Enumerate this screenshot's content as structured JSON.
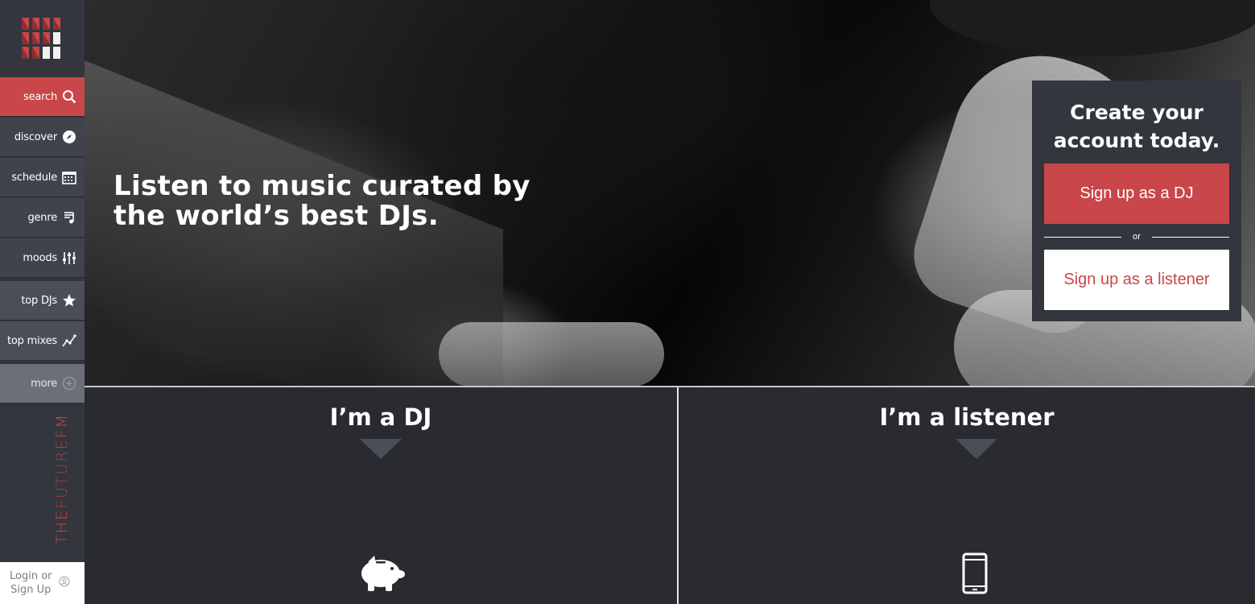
{
  "sidebar": {
    "items": [
      {
        "label": "search",
        "icon": "search-icon"
      },
      {
        "label": "discover",
        "icon": "compass-icon"
      },
      {
        "label": "schedule",
        "icon": "calendar-icon"
      },
      {
        "label": "genre",
        "icon": "music-note-icon"
      },
      {
        "label": "moods",
        "icon": "sliders-icon"
      },
      {
        "label": "top DJs",
        "icon": "star-icon"
      },
      {
        "label": "top mixes",
        "icon": "trend-line-icon"
      },
      {
        "label": "more",
        "icon": "plus-circle-icon"
      }
    ],
    "brand_part1": "THE",
    "brand_part2": "FUTURE",
    "brand_part3": "FM",
    "login_line1": "Login or",
    "login_line2": "Sign Up"
  },
  "hero": {
    "headline_line1": "Listen to music curated by",
    "headline_line2": "the world’s best DJs."
  },
  "signup": {
    "title_line1": "Create your",
    "title_line2": "account today.",
    "dj_button": "Sign up as a DJ",
    "or_text": "or",
    "listener_button": "Sign up as a listener"
  },
  "panels": {
    "dj_title": "I’m a DJ",
    "listener_title": "I’m a listener"
  },
  "colors": {
    "accent": "#c9464a",
    "sidebar": "#33363d",
    "panel": "#2a2b30"
  }
}
